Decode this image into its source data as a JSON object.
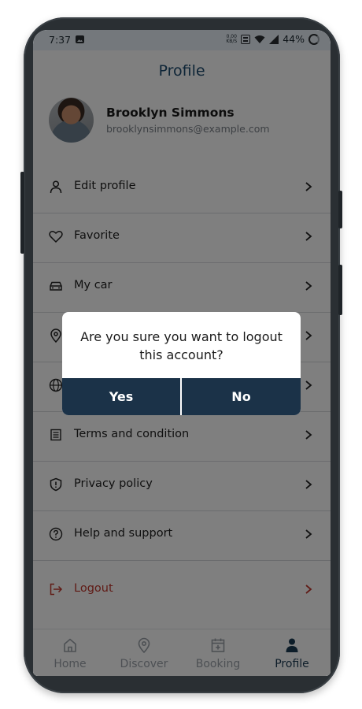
{
  "status_bar": {
    "time": "7:37",
    "net_speed_value": "0.00",
    "net_speed_unit": "KB/S",
    "battery": "44%"
  },
  "header": {
    "title": "Profile"
  },
  "user": {
    "name": "Brooklyn Simmons",
    "email": "brooklynsimmons@example.com"
  },
  "menu": [
    {
      "label": "Edit profile",
      "icon": "person-icon"
    },
    {
      "label": "Favorite",
      "icon": "heart-icon"
    },
    {
      "label": "My car",
      "icon": "car-icon"
    },
    {
      "label": "",
      "icon": "location-pin-icon"
    },
    {
      "label": "",
      "icon": "globe-icon"
    },
    {
      "label": "Terms and condition",
      "icon": "document-list-icon"
    },
    {
      "label": "Privacy policy",
      "icon": "shield-icon"
    },
    {
      "label": "Help and support",
      "icon": "question-circle-icon"
    },
    {
      "label": "Logout",
      "icon": "logout-icon"
    }
  ],
  "bottom_nav": [
    {
      "label": "Home",
      "icon": "home-icon",
      "active": false
    },
    {
      "label": "Discover",
      "icon": "location-pin-icon",
      "active": false
    },
    {
      "label": "Booking",
      "icon": "calendar-plus-icon",
      "active": false
    },
    {
      "label": "Profile",
      "icon": "person-filled-icon",
      "active": true
    }
  ],
  "dialog": {
    "message": "Are you sure you want to logout this account?",
    "yes_label": "Yes",
    "no_label": "No"
  },
  "colors": {
    "accent_dark": "#1b3248",
    "title_blue": "#1c4a6e",
    "logout_red": "#c0362c",
    "overlay": "rgba(0,0,0,0.5)"
  }
}
